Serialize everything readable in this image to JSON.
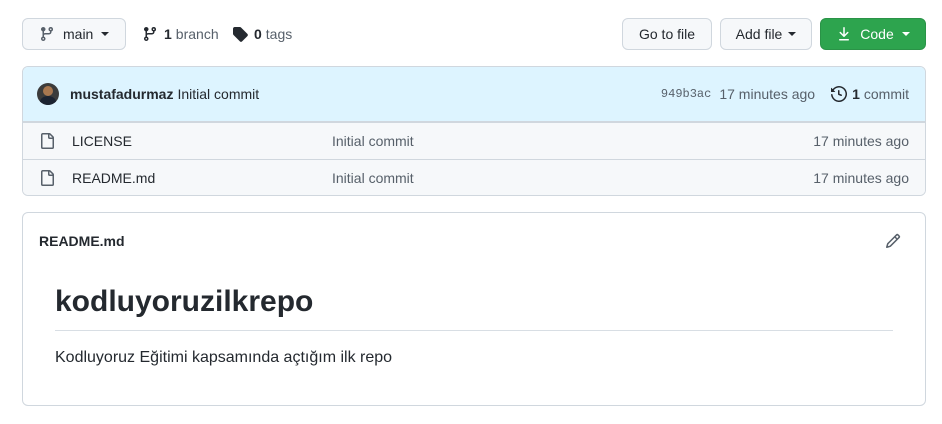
{
  "toolbar": {
    "branch_name": "main",
    "branch_count": "1",
    "branch_word": "branch",
    "tag_count": "0",
    "tag_word": "tags",
    "go_to_file": "Go to file",
    "add_file": "Add file",
    "code": "Code"
  },
  "commit": {
    "author": "mustafadurmaz",
    "message": "Initial commit",
    "sha": "949b3ac",
    "age": "17 minutes ago",
    "count": "1",
    "count_word": "commit"
  },
  "files": [
    {
      "name": "LICENSE",
      "message": "Initial commit",
      "age": "17 minutes ago"
    },
    {
      "name": "README.md",
      "message": "Initial commit",
      "age": "17 minutes ago"
    }
  ],
  "readme": {
    "filename": "README.md",
    "heading": "kodluyoruzilkrepo",
    "body": "Kodluyoruz Eğitimi kapsamında açtığım ilk repo"
  },
  "colors": {
    "accent_green": "#2da44e",
    "commit_bar_bg": "#ddf4ff",
    "border": "#d0d7de"
  },
  "icons": {
    "branch": "git-branch-icon",
    "tag": "tag-icon",
    "download": "download-icon",
    "history": "history-icon",
    "file": "file-icon",
    "edit": "pencil-icon"
  }
}
